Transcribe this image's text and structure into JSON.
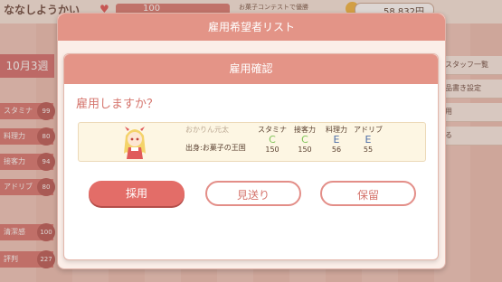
{
  "background": {
    "shop_name": "ななしようかい",
    "hearts_value": "100",
    "subtitle": "お菓子コンテストで優勝",
    "money": "58,832円",
    "week": "10月3週",
    "stats": [
      {
        "label": "スタミナ",
        "value": "99"
      },
      {
        "label": "料理力",
        "value": "80"
      },
      {
        "label": "接客力",
        "value": "94"
      },
      {
        "label": "アドリブ",
        "value": "80"
      },
      {
        "label": "清潔感",
        "value": "100"
      },
      {
        "label": "評判",
        "value": "227"
      }
    ],
    "menu": [
      "スタッフ一覧",
      "品書き設定",
      "用",
      "る"
    ]
  },
  "outer_dialog": {
    "title": "雇用希望者リスト"
  },
  "confirm_dialog": {
    "title": "雇用確認",
    "question": "雇用しますか？",
    "candidate": {
      "name": "おかりん元太",
      "origin": "出身:お菓子の王国",
      "stats": [
        {
          "label": "スタミナ",
          "grade": "C",
          "value": "150",
          "color": "#7fc458"
        },
        {
          "label": "接客力",
          "grade": "C",
          "value": "150",
          "color": "#7fc458"
        },
        {
          "label": "料理力",
          "grade": "E",
          "value": "56",
          "color": "#4d6ea8"
        },
        {
          "label": "アドリブ",
          "grade": "E",
          "value": "55",
          "color": "#4d6ea8"
        }
      ]
    },
    "buttons": {
      "hire": "採用",
      "skip": "見送り",
      "hold": "保留"
    }
  }
}
